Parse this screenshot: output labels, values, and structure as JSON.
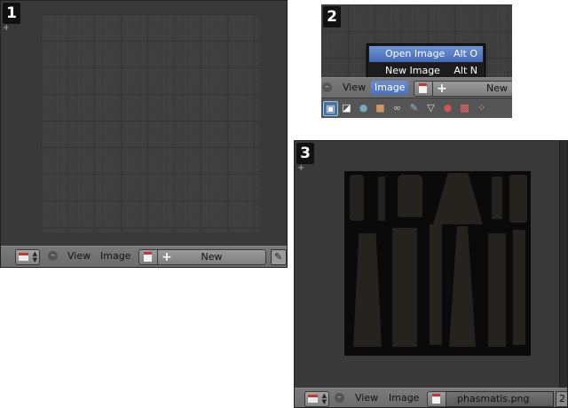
{
  "panels": [
    {
      "number": "1",
      "header": {
        "view_label": "View",
        "image_label": "Image",
        "new_label": "New"
      }
    },
    {
      "number": "2",
      "dropdown": {
        "items": [
          {
            "label": "Open Image",
            "shortcut": "Alt O",
            "highlighted": true
          },
          {
            "label": "New Image",
            "shortcut": "Alt N",
            "highlighted": false
          }
        ]
      },
      "header": {
        "view_label": "View",
        "image_label": "Image",
        "image_menu_active": true,
        "new_label": "New"
      },
      "properties_icons": [
        "camera-render-icon",
        "render-layers-icon",
        "world-icon",
        "object-icon",
        "constraints-icon",
        "wrench-modifier-icon",
        "vertex-data-icon",
        "material-icon",
        "texture-icon",
        "particles-icon"
      ]
    },
    {
      "number": "3",
      "header": {
        "view_label": "View",
        "image_label": "Image",
        "filename": "phasmatis.png",
        "user_count": "2"
      }
    }
  ],
  "colors": {
    "highlight": "#5a7fc8",
    "header_bg": "#727272",
    "editor_bg": "#3e3e3e",
    "texture_bg": "#0a0a0a"
  }
}
